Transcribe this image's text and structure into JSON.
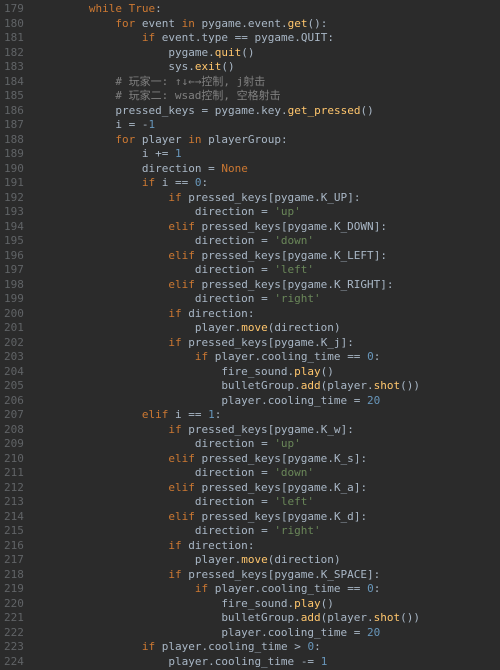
{
  "line_start": 179,
  "kw": {
    "while": "while",
    "True": "True",
    "for": "for",
    "in": "in",
    "if": "if",
    "elif": "elif",
    "None": "None"
  },
  "ident": {
    "event": "event",
    "pygame": "pygame",
    "event_mod": "event",
    "type": "type",
    "QUIT": "QUIT",
    "sys": "sys",
    "pressed_keys": "pressed_keys",
    "key": "key",
    "i": "i",
    "player": "player",
    "playerGroup": "playerGroup",
    "direction": "direction",
    "K_UP": "K_UP",
    "K_DOWN": "K_DOWN",
    "K_LEFT": "K_LEFT",
    "K_RIGHT": "K_RIGHT",
    "K_j": "K_j",
    "K_w": "K_w",
    "K_s": "K_s",
    "K_a": "K_a",
    "K_d": "K_d",
    "K_SPACE": "K_SPACE",
    "cooling_time": "cooling_time",
    "fire_sound": "fire_sound",
    "bulletGroup": "bulletGroup"
  },
  "call": {
    "get": "get",
    "quit": "quit",
    "exit": "exit",
    "get_pressed": "get_pressed",
    "move": "move",
    "play": "play",
    "add": "add",
    "shot": "shot"
  },
  "str": {
    "up": "'up'",
    "down": "'down'",
    "left": "'left'",
    "right": "'right'"
  },
  "num": {
    "neg1": "1",
    "n0": "0",
    "n1": "1",
    "n20": "20"
  },
  "comment": {
    "c1": "# 玩家一: ↑↓←→控制, j射击",
    "c2": "# 玩家二: wsad控制, 空格射击"
  },
  "op": {
    "colon": ":",
    "dot": ".",
    "eq": "=",
    "deq": "==",
    "pluseq": "+=",
    "minuseq": "-=",
    "minus": "-",
    "gt": ">",
    "lparen": "(",
    "rparen": ")",
    "lbrack": "[",
    "rbrack": "]"
  }
}
